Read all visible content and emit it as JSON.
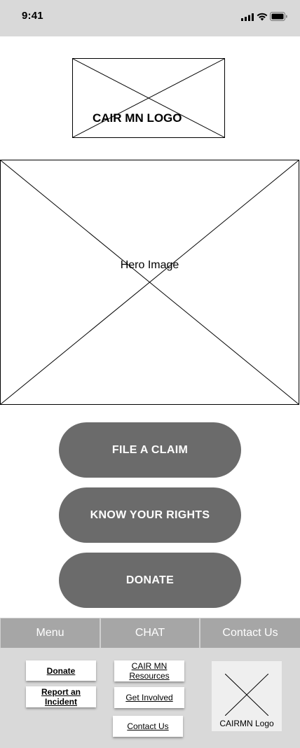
{
  "status_bar": {
    "time": "9:41"
  },
  "header": {
    "logo_text": "CAIR MN LOGO"
  },
  "hero": {
    "label": "Hero Image"
  },
  "actions": [
    {
      "label": "FILE A CLAIM"
    },
    {
      "label": "KNOW YOUR RIGHTS"
    },
    {
      "label": "DONATE"
    }
  ],
  "nav": {
    "tabs": [
      {
        "label": "Menu"
      },
      {
        "label": "CHAT"
      },
      {
        "label": "Contact Us"
      }
    ]
  },
  "footer": {
    "links": [
      {
        "label": "Donate"
      },
      {
        "label": "Report an Incident"
      },
      {
        "label": "CAIR MN Resources"
      },
      {
        "label": "Get Involved"
      },
      {
        "label": "Contact Us"
      }
    ],
    "logo_label": "CAIRMN Logo"
  },
  "colors": {
    "cta": "#6b6b6b",
    "nav_tab": "#a6a6a6",
    "status_bar": "#d9d9d9",
    "footer": "#d9d9d9"
  }
}
